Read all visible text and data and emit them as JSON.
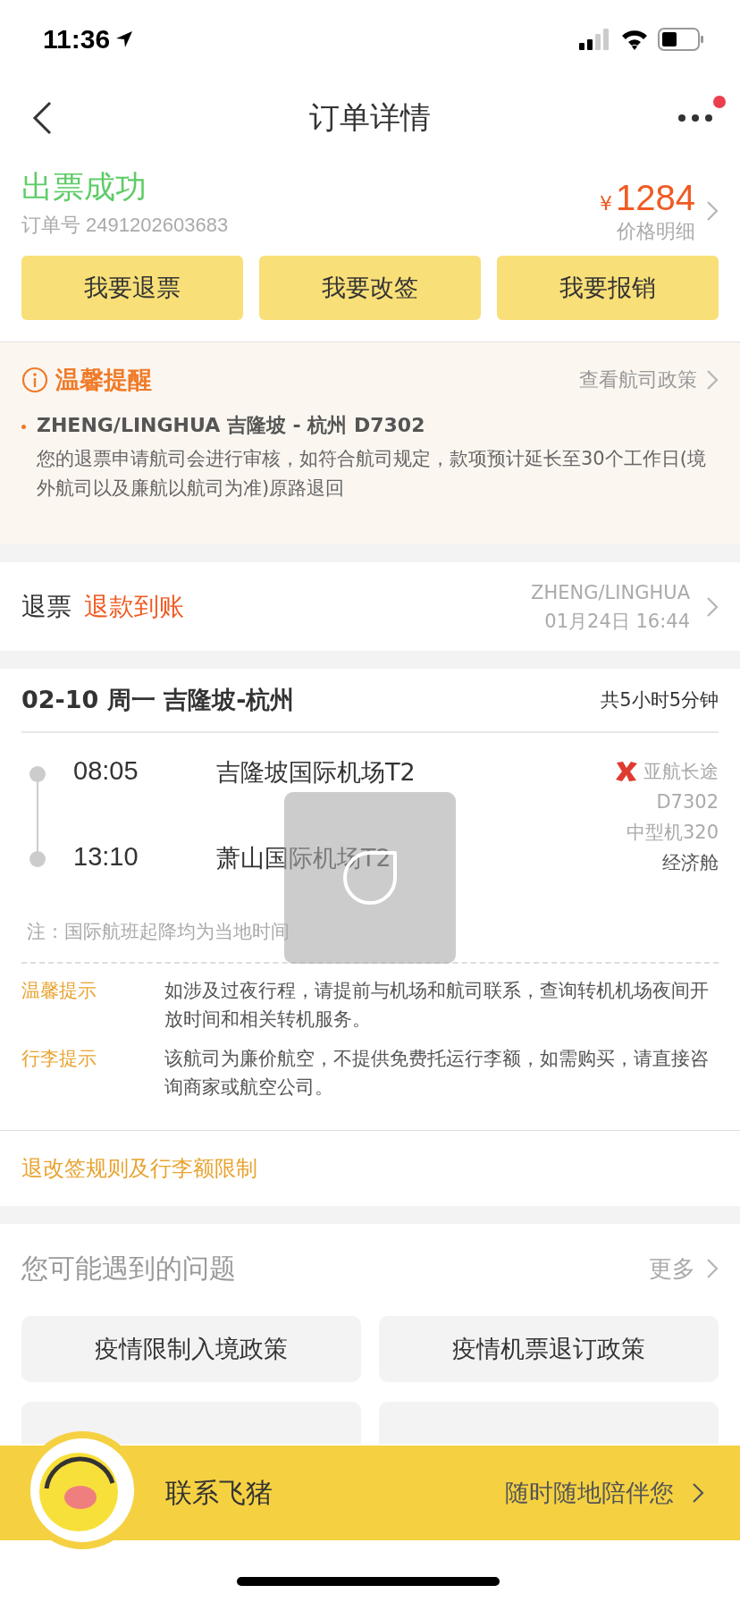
{
  "status_bar": {
    "time": "11:36"
  },
  "nav": {
    "title": "订单详情",
    "notification_dot": true
  },
  "order": {
    "status": "出票成功",
    "order_number": "订单号 2491202603683",
    "currency": "¥",
    "price": "1284",
    "price_link": "价格明细"
  },
  "actions": [
    "我要退票",
    "我要改签",
    "我要报销"
  ],
  "notice": {
    "title": "温馨提醒",
    "link": "查看航司政策",
    "items": [
      {
        "heading": "ZHENG/LINGHUA 吉隆坡 - 杭州 D7302",
        "body": "您的退票申请航司会进行审核，如符合航司规定，款项预计延长至30个工作日(境外航司以及廉航以航司为准)原路退回"
      }
    ]
  },
  "refund": {
    "type": "退票",
    "status": "退款到账",
    "passenger": "ZHENG/LINGHUA",
    "time": "01月24日 16:44"
  },
  "flight": {
    "header": "02-10 周一 吉隆坡-杭州",
    "duration": "共5小时5分钟",
    "departure": {
      "time": "08:05",
      "airport": "吉隆坡国际机场T2"
    },
    "arrival": {
      "time": "13:10",
      "airport": "萧山国际机场T2"
    },
    "airline": "亚航长途",
    "flight_no": "D7302",
    "aircraft": "中型机320",
    "cabin": "经济舱",
    "note": "注：国际航班起降均为当地时间",
    "tips": [
      {
        "label": "温馨提示",
        "text": "如涉及过夜行程，请提前与机场和航司联系，查询转机机场夜间开放时间和相关转机服务。"
      },
      {
        "label": "行李提示",
        "text": "该航司为廉价航空，不提供免费托运行李额，如需购买，请直接咨询商家或航空公司。"
      }
    ],
    "rules_link": "退改签规则及行李额限制"
  },
  "questions": {
    "title": "您可能遇到的问题",
    "more": "更多",
    "items": [
      {
        "kind": "full",
        "label": "疫情限制入境政策"
      },
      {
        "kind": "full",
        "label": "疫情机票退订政策"
      },
      {
        "kind": "covered"
      },
      {
        "kind": "covered"
      }
    ]
  },
  "contact_bar": {
    "label": "联系飞猪",
    "tagline": "随时随地陪伴您"
  }
}
